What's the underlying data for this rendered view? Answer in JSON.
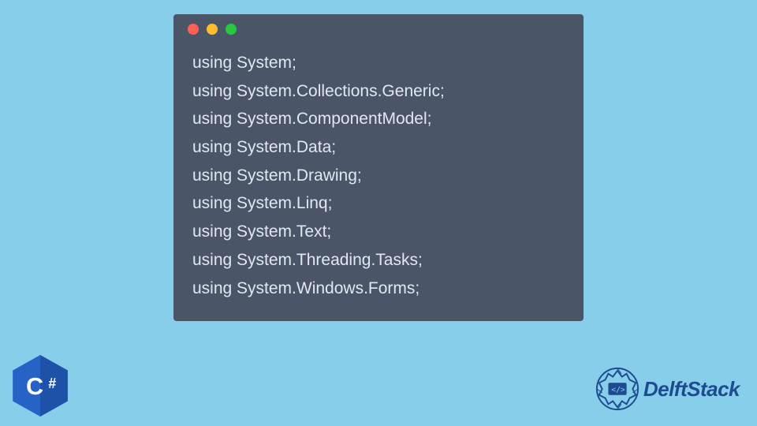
{
  "code": {
    "lines": [
      "using System;",
      "using System.Collections.Generic;",
      "using System.ComponentModel;",
      "using System.Data;",
      "using System.Drawing;",
      "using System.Linq;",
      "using System.Text;",
      "using System.Threading.Tasks;",
      "using System.Windows.Forms;"
    ]
  },
  "badge": {
    "text": "C#"
  },
  "brand": {
    "name": "DelftStack"
  },
  "colors": {
    "background": "#87ceeb",
    "codeWindow": "#4a5568",
    "codeText": "#e2e8f0",
    "dotRed": "#ff5f56",
    "dotYellow": "#ffbd2e",
    "dotGreen": "#27c93f",
    "badgeBlue": "#2563c7",
    "brandBlue": "#1e4a8f"
  }
}
